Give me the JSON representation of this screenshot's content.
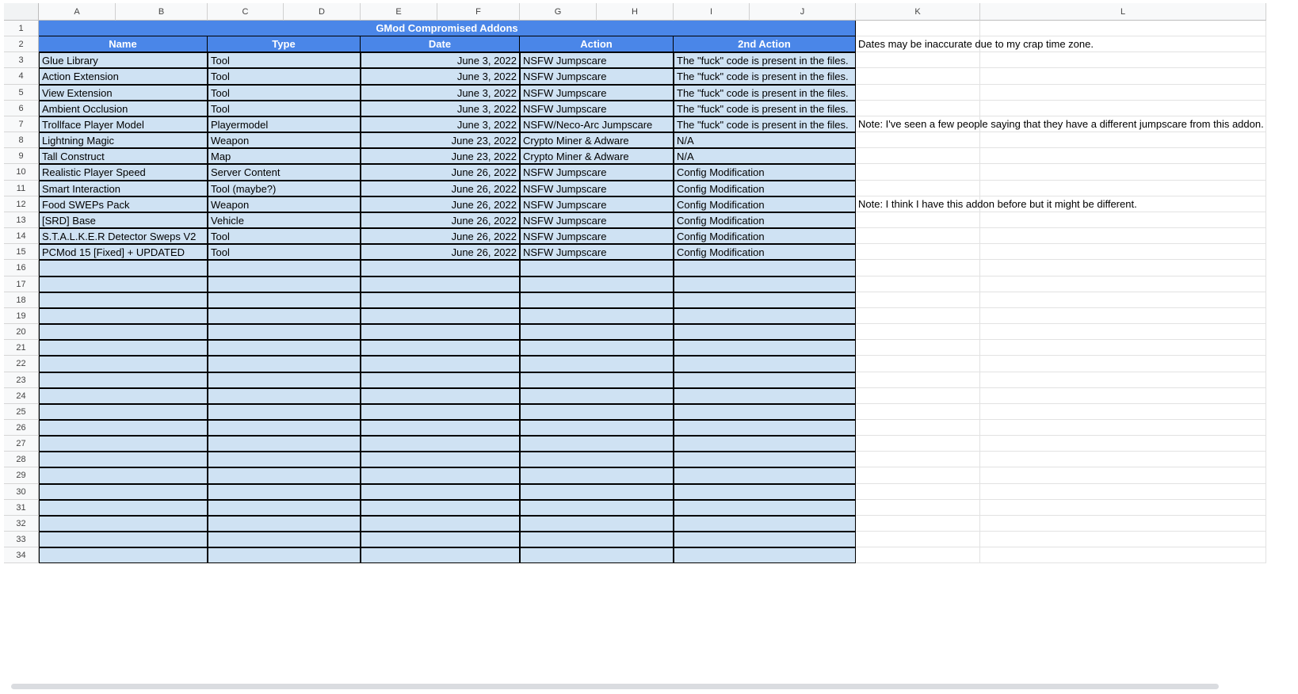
{
  "columns": [
    "A",
    "B",
    "C",
    "D",
    "E",
    "F",
    "G",
    "H",
    "I",
    "J",
    "K",
    "L"
  ],
  "rows": [
    "1",
    "2",
    "3",
    "4",
    "5",
    "6",
    "7",
    "8",
    "9",
    "10",
    "11",
    "12",
    "13",
    "14",
    "15",
    "16",
    "17",
    "18",
    "19",
    "20",
    "21",
    "22",
    "23",
    "24",
    "25",
    "26",
    "27",
    "28",
    "29",
    "30",
    "31",
    "32",
    "33",
    "34"
  ],
  "title": "GMod Compromised Addons",
  "headers": [
    "Name",
    "Type",
    "Date",
    "Action",
    "2nd Action"
  ],
  "data": [
    [
      "Glue Library",
      "Tool",
      "June 3, 2022",
      "NSFW Jumpscare",
      "The \"fuck\" code is present in the files."
    ],
    [
      "Action Extension",
      "Tool",
      "June 3, 2022",
      "NSFW Jumpscare",
      "The \"fuck\" code is present in the files."
    ],
    [
      "View Extension",
      "Tool",
      "June 3, 2022",
      "NSFW Jumpscare",
      "The \"fuck\" code is present in the files."
    ],
    [
      "Ambient Occlusion",
      "Tool",
      "June 3, 2022",
      "NSFW Jumpscare",
      "The \"fuck\" code is present in the files."
    ],
    [
      "Trollface Player Model",
      "Playermodel",
      "June 3, 2022",
      "NSFW/Neco-Arc Jumpscare",
      "The \"fuck\" code is present in the files."
    ],
    [
      "Lightning Magic",
      "Weapon",
      "June 23, 2022",
      "Crypto Miner & Adware",
      "N/A"
    ],
    [
      "Tall Construct",
      "Map",
      "June 23, 2022",
      "Crypto Miner & Adware",
      "N/A"
    ],
    [
      "Realistic Player Speed",
      "Server Content",
      "June 26, 2022",
      "NSFW Jumpscare",
      "Config Modification"
    ],
    [
      "Smart Interaction",
      "Tool (maybe?)",
      "June 26, 2022",
      "NSFW Jumpscare",
      "Config Modification"
    ],
    [
      "Food SWEPs Pack",
      "Weapon",
      "June 26, 2022",
      "NSFW Jumpscare",
      "Config Modification"
    ],
    [
      "[SRD] Base",
      "Vehicle",
      "June 26, 2022",
      "NSFW Jumpscare",
      "Config Modification"
    ],
    [
      "S.T.A.L.K.E.R Detector Sweps V2",
      "Tool",
      "June 26, 2022",
      "NSFW Jumpscare",
      "Config Modification"
    ],
    [
      "PCMod 15 [Fixed] + UPDATED",
      "Tool",
      "June 26, 2022",
      "NSFW Jumpscare",
      "Config Modification"
    ]
  ],
  "notes": {
    "k2": "Dates may be inaccurate due to my crap time zone.",
    "k7": "Note: I've seen a few people saying that they have a different jumpscare from this addon.",
    "k12": "Note: I think I have this addon before but it might be different."
  },
  "colors": {
    "header_blue": "#4a86e8",
    "table_fill": "#cfe2f3",
    "grid_header": "#f8f9fa"
  }
}
